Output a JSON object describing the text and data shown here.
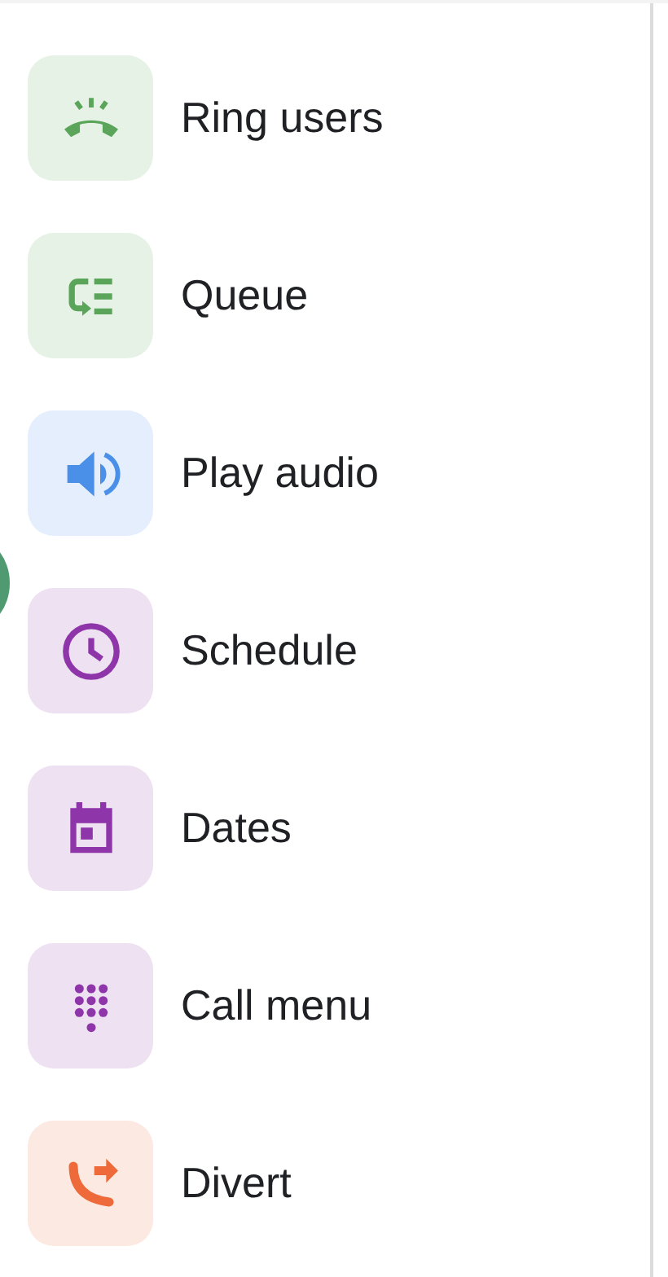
{
  "items": [
    {
      "label": "Ring users",
      "kind": "ring",
      "color": "#5aa55a"
    },
    {
      "label": "Queue",
      "kind": "queue",
      "color": "#5aa55a"
    },
    {
      "label": "Play audio",
      "kind": "speaker",
      "color": "#4a90e8"
    },
    {
      "label": "Schedule",
      "kind": "clock",
      "color": "#8e35aa"
    },
    {
      "label": "Dates",
      "kind": "calendar",
      "color": "#8e35aa"
    },
    {
      "label": "Call menu",
      "kind": "dialpad",
      "color": "#8e35aa"
    },
    {
      "label": "Divert",
      "kind": "divert",
      "color": "#ee6a3a"
    }
  ]
}
